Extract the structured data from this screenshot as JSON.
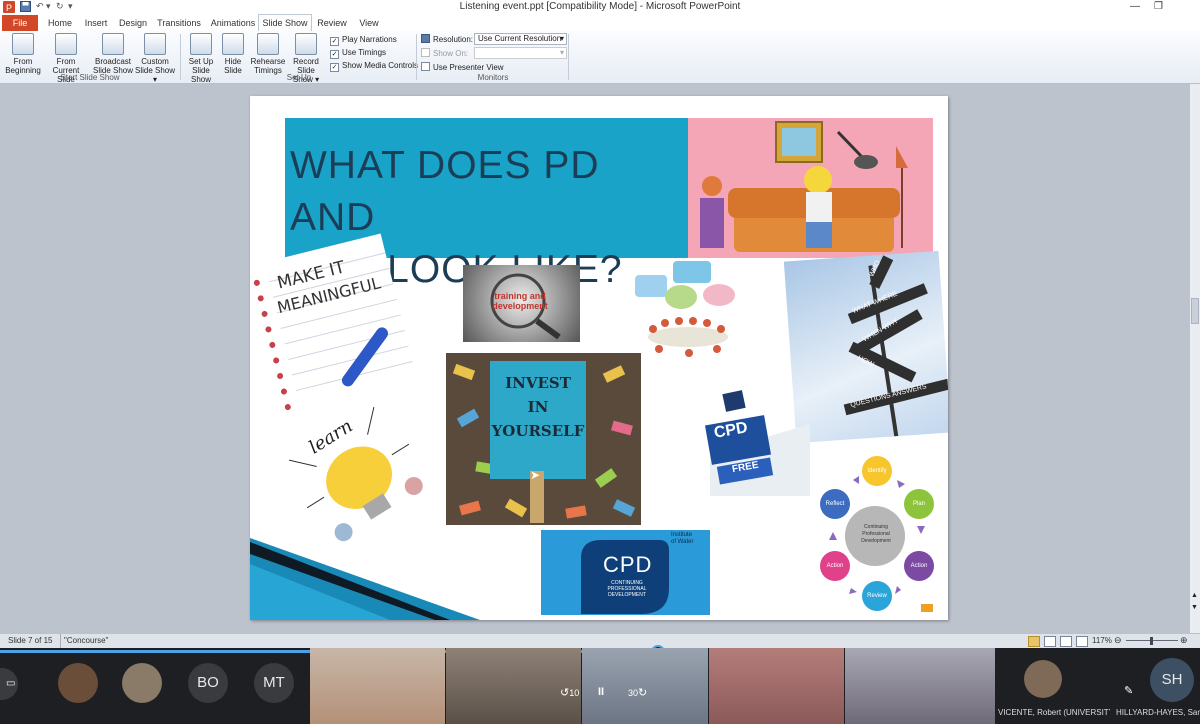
{
  "window": {
    "title": "Listening event.ppt [Compatibility Mode] - Microsoft PowerPoint",
    "minimize": "—",
    "restore": "❐"
  },
  "tabs": [
    "File",
    "Home",
    "Insert",
    "Design",
    "Transitions",
    "Animations",
    "Slide Show",
    "Review",
    "View"
  ],
  "ribbon": {
    "start_group": {
      "label": "Start Slide Show",
      "buttons": [
        {
          "line1": "From",
          "line2": "Beginning"
        },
        {
          "line1": "From",
          "line2": "Current Slide"
        },
        {
          "line1": "Broadcast",
          "line2": "Slide Show"
        },
        {
          "line1": "Custom",
          "line2": "Slide Show ▾"
        }
      ]
    },
    "setup_group": {
      "label": "Set Up",
      "buttons": [
        {
          "line1": "Set Up",
          "line2": "Slide Show"
        },
        {
          "line1": "Hide",
          "line2": "Slide"
        },
        {
          "line1": "Rehearse",
          "line2": "Timings"
        },
        {
          "line1": "Record Slide",
          "line2": "Show ▾"
        }
      ],
      "checks": [
        {
          "label": "Play Narrations",
          "checked": "✓"
        },
        {
          "label": "Use Timings",
          "checked": "✓"
        },
        {
          "label": "Show Media Controls",
          "checked": "✓"
        }
      ]
    },
    "monitors_group": {
      "label": "Monitors",
      "resolution_label": "Resolution:",
      "resolution_value": "Use Current Resolution",
      "show_on_label": "Show On:",
      "show_on_value": "",
      "presenter_view_label": "Use Presenter View"
    }
  },
  "slide": {
    "title_line1": "WHAT DOES PD AND",
    "title_line2": "CPD LOOK LIKE?",
    "images": {
      "meaningful_l1": "MAKE IT",
      "meaningful_l2": "MEANINGFUL",
      "training_l1": "training and",
      "training_l2": "development",
      "invest_l1": "INVEST",
      "invest_l2": "IN",
      "invest_l3": "YOURSELF",
      "learn": "learn",
      "cpd_sign": "CPD",
      "cpd_free": "FREE",
      "signpost": [
        "WHO",
        "WHAT",
        "WHERE",
        "WHEN",
        "WHY",
        "HOW",
        "QUESTIONS",
        "ANSWERS"
      ],
      "water_big": "CPD",
      "water_sub1": "CONTINUING",
      "water_sub2": "PROFESSIONAL",
      "water_sub3": "DEVELOPMENT",
      "water_brand1": "Institute",
      "water_brand2": "of Water",
      "cycle_center1": "Continuing",
      "cycle_center2": "Professional",
      "cycle_center3": "Development",
      "cycle_nodes": [
        "Identify",
        "Plan",
        "Action",
        "Review",
        "Action",
        "Reflect"
      ]
    }
  },
  "statusbar": {
    "slide": "Slide 7 of 15",
    "theme": "\"Concourse\"",
    "zoom": "117%"
  },
  "call": {
    "avatars": [
      "BO",
      "MT",
      "SH"
    ],
    "skip_back": "10",
    "skip_fwd": "30",
    "pause": "II",
    "name1": "VICENTE, Robert (UNIVERSITY COLL...",
    "name2": "HILLYARD-HAYES, Sarah",
    "colors": {
      "bo": "#3a3b3e",
      "mt": "#3a3b3e",
      "sh": "#3d5063"
    }
  }
}
